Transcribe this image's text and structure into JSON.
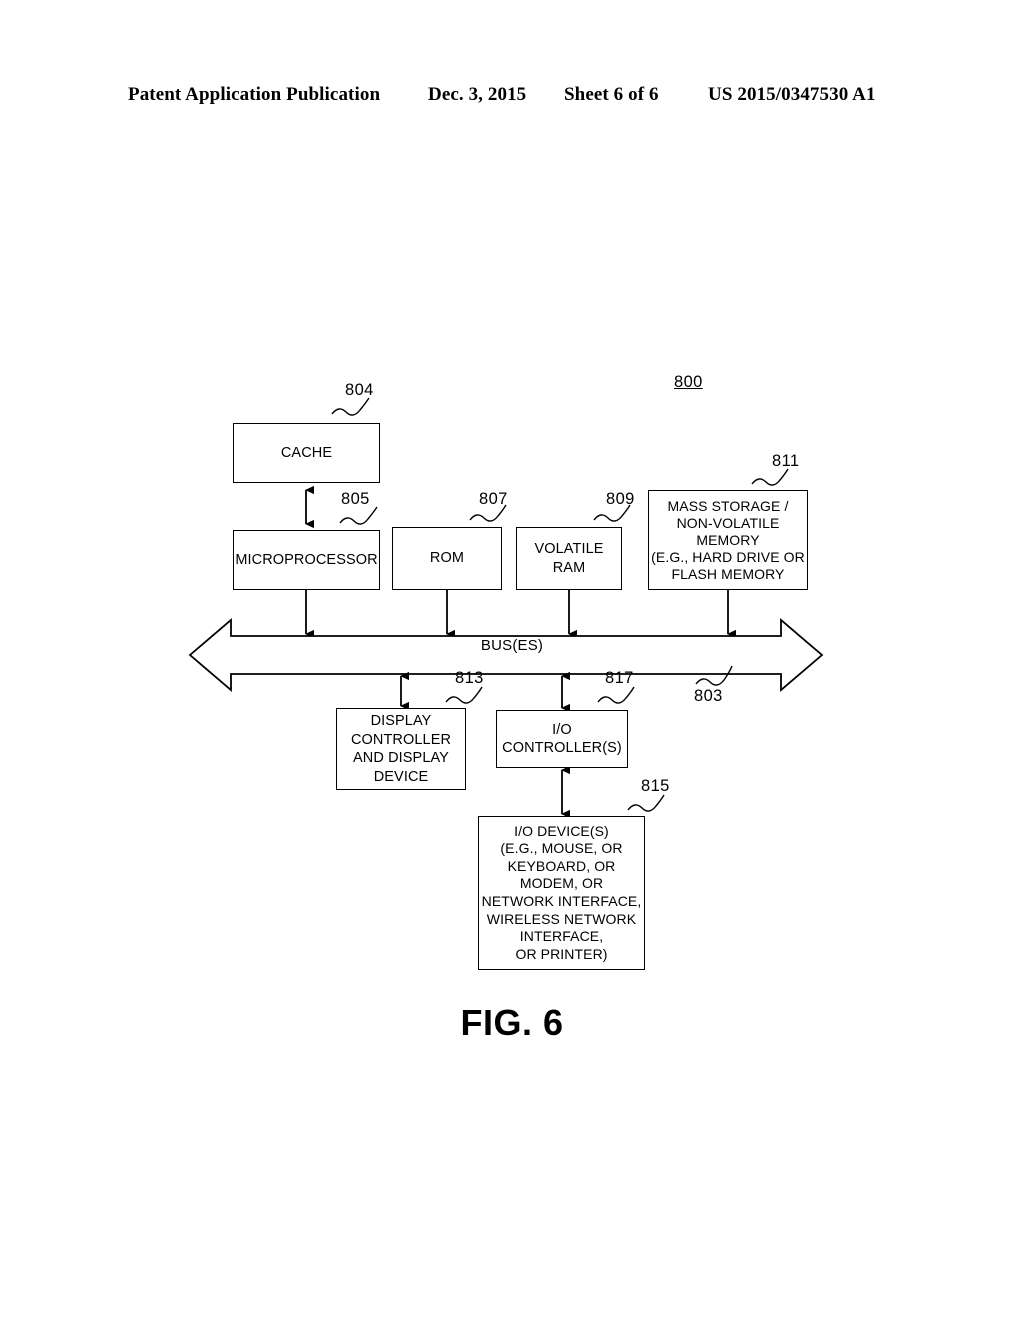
{
  "header": {
    "title": "Patent Application Publication",
    "date": "Dec. 3, 2015",
    "sheet": "Sheet 6 of 6",
    "number": "US 2015/0347530 A1"
  },
  "figure": {
    "caption": "FIG. 6",
    "system_ref": "800",
    "bus_label": "BUS(ES)",
    "bus_ref": "803",
    "blocks": [
      {
        "id": "cache",
        "ref": "804",
        "lines": [
          "CACHE"
        ]
      },
      {
        "id": "micro",
        "ref": "805",
        "lines": [
          "MICROPROCESSOR"
        ]
      },
      {
        "id": "rom",
        "ref": "807",
        "lines": [
          "ROM"
        ]
      },
      {
        "id": "vram",
        "ref": "809",
        "lines": [
          "VOLATILE",
          "RAM"
        ]
      },
      {
        "id": "mass",
        "ref": "811",
        "lines": [
          "MASS STORAGE /",
          "NON-VOLATILE",
          "MEMORY",
          "(E.G., HARD DRIVE OR",
          "FLASH MEMORY"
        ]
      },
      {
        "id": "display",
        "ref": "813",
        "lines": [
          "DISPLAY",
          "CONTROLLER",
          "AND DISPLAY",
          "DEVICE"
        ]
      },
      {
        "id": "ioctrl",
        "ref": "817",
        "lines": [
          "I/O",
          "CONTROLLER(S)"
        ]
      },
      {
        "id": "iodev",
        "ref": "815",
        "lines": [
          "I/O DEVICE(S)",
          "(E.G., MOUSE, OR",
          "KEYBOARD, OR",
          "MODEM, OR",
          "NETWORK INTERFACE,",
          "WIRELESS NETWORK",
          "INTERFACE,",
          "OR PRINTER)"
        ]
      }
    ]
  }
}
